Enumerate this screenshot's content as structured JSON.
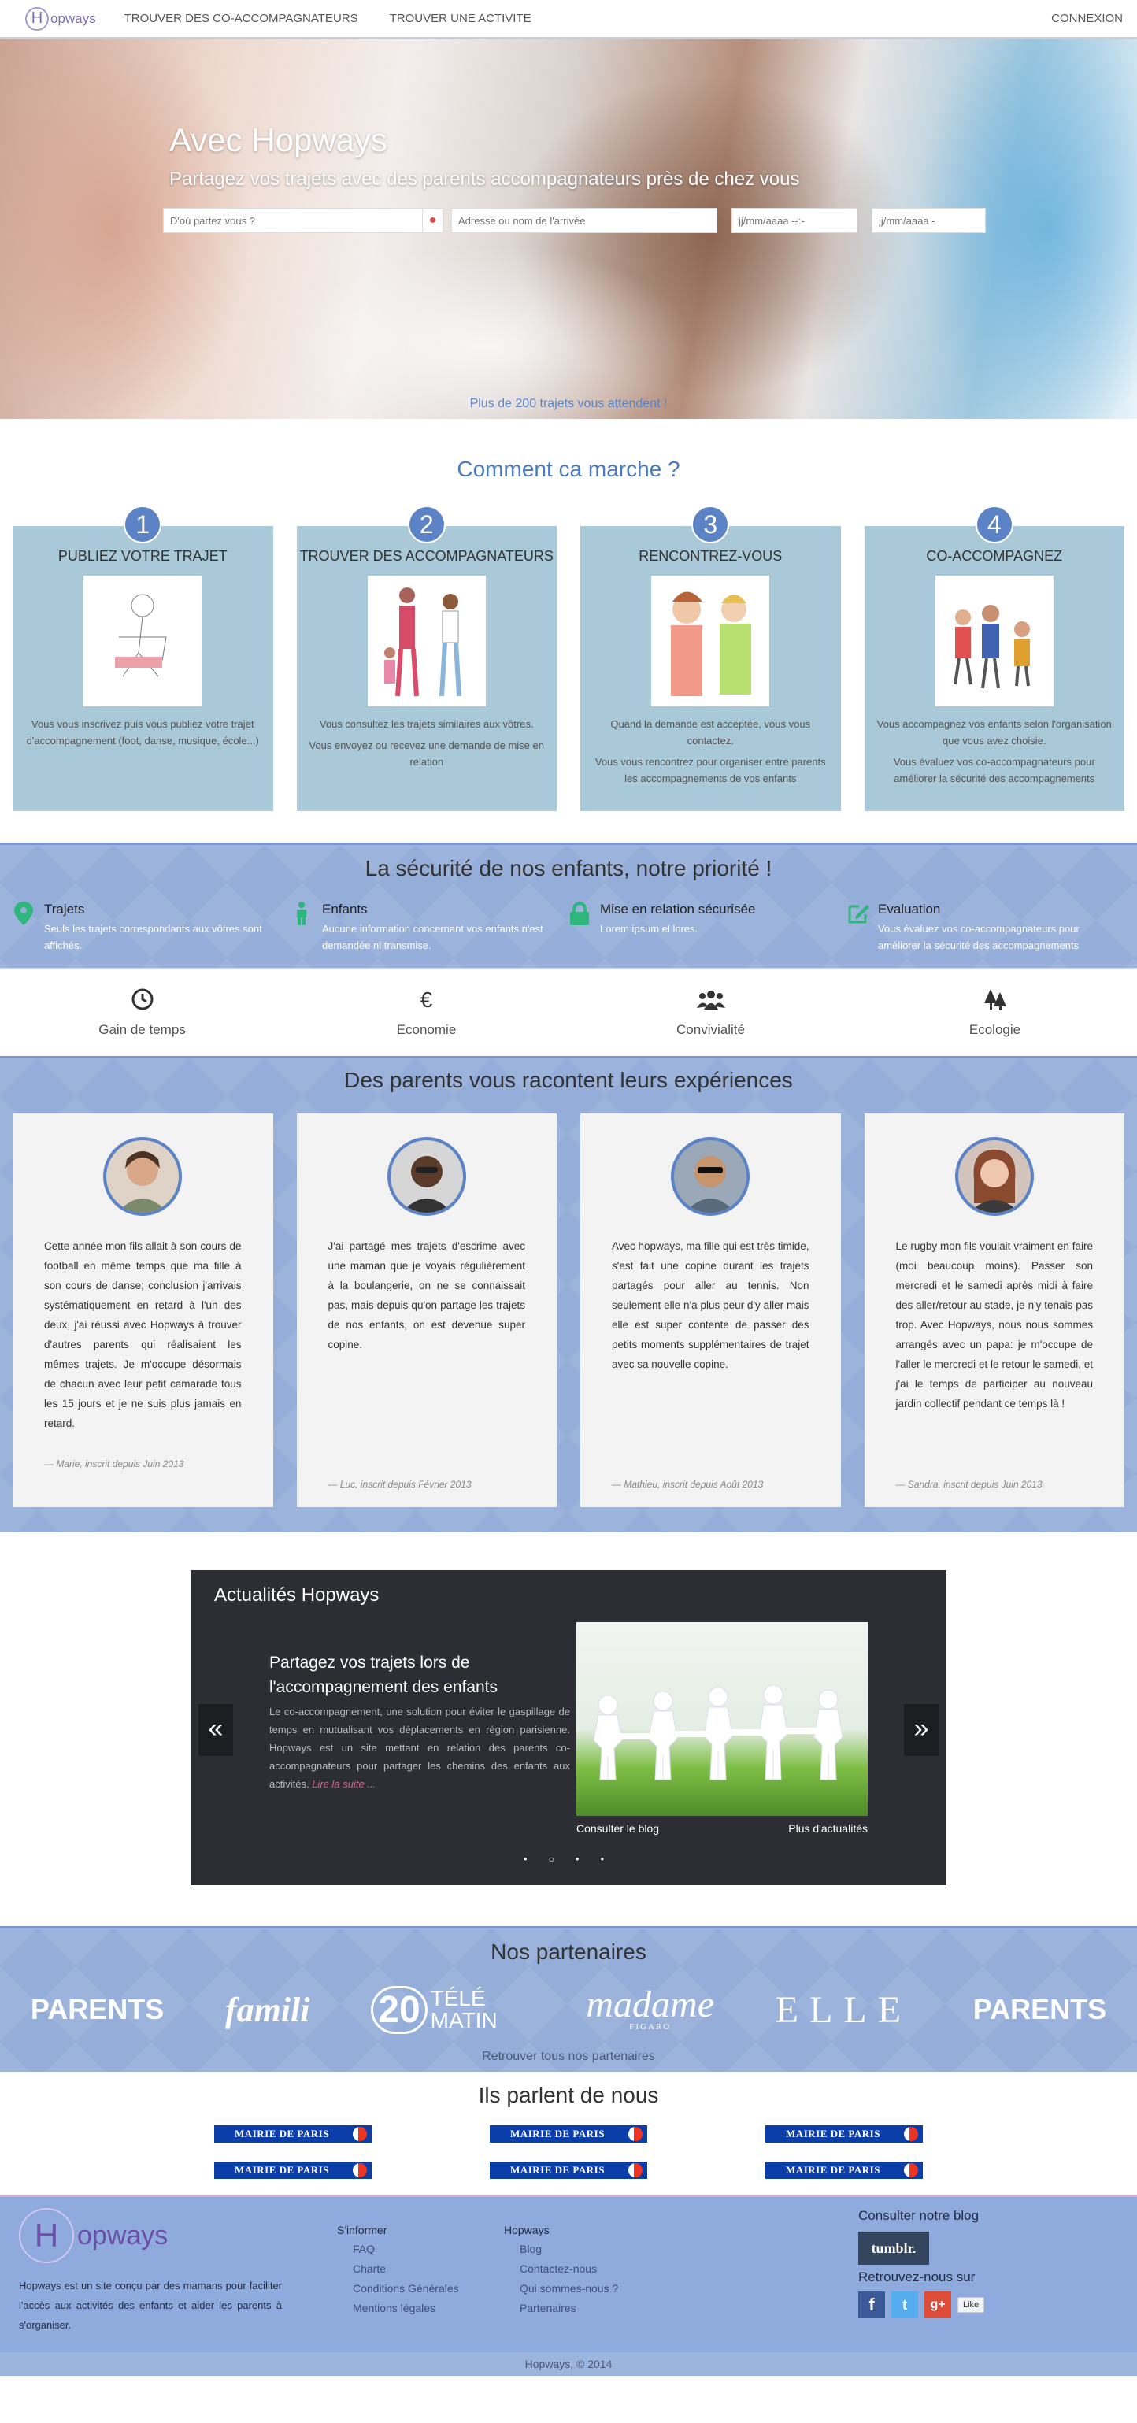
{
  "nav": {
    "logo_letter": "H",
    "logo_text": "opways",
    "links": [
      "TROUVER DES CO-ACCOMPAGNATEURS",
      "TROUVER UNE ACTIVITE"
    ],
    "login": "CONNEXION"
  },
  "hero": {
    "title": "Avec Hopways",
    "subtitle": "Partagez vos trajets avec des parents accompagnateurs près de chez vous",
    "from_placeholder": "D'où partez vous ?",
    "to_placeholder": "Adresse ou nom de l'arrivée",
    "date1_placeholder": "jj/mm/aaaa --:-",
    "date2_placeholder": "jj/mm/aaaa -",
    "more": "Plus de 200 trajets vous attendent !"
  },
  "how": {
    "title": "Comment ca marche ?",
    "steps": [
      {
        "num": "1",
        "title": "PUBLIEZ VOTRE TRAJET",
        "p1": "Vous vous inscrivez puis vous publiez votre trajet d'accompagnement (foot, danse, musique, école...)",
        "p2": ""
      },
      {
        "num": "2",
        "title": "TROUVER DES ACCOMPAGNATEURS",
        "p1": "Vous consultez les trajets similaires aux vôtres.",
        "p2": "Vous envoyez ou recevez une demande de mise en relation"
      },
      {
        "num": "3",
        "title": "RENCONTREZ-VOUS",
        "p1": "Quand la demande est acceptée, vous vous contactez.",
        "p2": "Vous vous rencontrez pour organiser entre parents les accompagnements de vos enfants"
      },
      {
        "num": "4",
        "title": "CO-ACCOMPAGNEZ",
        "p1": "Vous accompagnez vos enfants selon l'organisation que vous avez choisie.",
        "p2": "Vous évaluez vos co-accompagnateurs pour améliorer la sécurité des accompagnements"
      }
    ]
  },
  "safety": {
    "title": "La sécurité de nos enfants, notre priorité !",
    "items": [
      {
        "title": "Trajets",
        "text": "Seuls les trajets correspondants aux vôtres sont affichés."
      },
      {
        "title": "Enfants",
        "text": "Aucune information concernant vos enfants n'est demandée ni transmise."
      },
      {
        "title": "Mise en relation sécurisée",
        "text": "Lorem ipsum el lores."
      },
      {
        "title": "Evaluation",
        "text": "Vous évaluez vos co-accompagnateurs pour améliorer la sécurité des accompagnements"
      }
    ]
  },
  "benefits": [
    "Gain de temps",
    "Economie",
    "Convivialité",
    "Ecologie"
  ],
  "testimonials": {
    "title": "Des parents vous racontent leurs expériences",
    "items": [
      {
        "text": "Cette année mon fils allait à son cours de football en même temps que ma fille à son cours de danse; conclusion j'arrivais systématiquement en retard à l'un des deux, j'ai réussi avec Hopways à trouver d'autres parents qui réalisaient les mêmes trajets. Je m'occupe désormais de chacun avec leur petit camarade tous les 15 jours et je ne suis plus jamais en retard.",
        "sig": "— Marie, inscrit depuis Juin 2013"
      },
      {
        "text": "J'ai partagé mes trajets d'escrime avec une maman que je voyais régulièrement à la boulangerie, on ne se connaissait pas, mais depuis qu'on partage les trajets de nos enfants, on est devenue super copine.",
        "sig": "— Luc, inscrit depuis Février 2013"
      },
      {
        "text": "Avec hopways, ma fille qui est très timide, s'est fait une copine durant les trajets partagés pour aller au tennis. Non seulement elle n'a plus peur d'y aller mais elle est super contente de passer des petits moments supplémentaires de trajet avec sa nouvelle copine.",
        "sig": "— Mathieu, inscrit depuis Août 2013"
      },
      {
        "text": "Le rugby mon fils voulait vraiment en faire (moi beaucoup moins). Passer son mercredi et le samedi après midi à faire des aller/retour au stade, je n'y tenais pas trop. Avec Hopways, nous nous sommes arrangés avec un papa: je m'occupe de l'aller le mercredi et le retour le samedi, et j'ai le temps de participer au nouveau jardin collectif pendant ce temps là !",
        "sig": "— Sandra, inscrit depuis Juin 2013"
      }
    ]
  },
  "news": {
    "title": "Actualités Hopways",
    "headline": "Partagez vos trajets lors de l'accompagnement des enfants",
    "body": "Le co-accompagnement, une solution pour éviter le gaspillage de temps en mutualisant vos déplacements en région parisienne. Hopways est un site mettant en relation des parents co-accompagnateurs pour partager les chemins des enfants aux activités.",
    "read_more": "Lire la suite ...",
    "blog_link": "Consulter le blog",
    "more_link": "Plus d'actualités",
    "prev": "«",
    "next": "»",
    "dots": "• ○ • •"
  },
  "partners": {
    "title": "Nos partenaires",
    "logos": [
      "PARENTS",
      "famili",
      "TÉLÉ MATIN",
      "madame",
      "ELLE",
      "PARENTS"
    ],
    "telematin_num": "20",
    "madame_sub": "FIGARO",
    "all": "Retrouver tous nos partenaires"
  },
  "press": {
    "title": "Ils parlent de nous",
    "items": [
      "MAIRIE DE PARIS",
      "MAIRIE DE PARIS",
      "MAIRIE DE PARIS",
      "MAIRIE DE PARIS",
      "MAIRIE DE PARIS",
      "MAIRIE DE PARIS"
    ]
  },
  "footer": {
    "logo_letter": "H",
    "logo_text": "opways",
    "about": "Hopways est un site conçu par des mamans pour faciliter l'accès aux activités des enfants et aider les parents à s'organiser.",
    "col1": {
      "title": "S'informer",
      "links": [
        "FAQ",
        "Charte",
        "Conditions Générales",
        "Mentions légales"
      ]
    },
    "col2": {
      "title": "Hopways",
      "links": [
        "Blog",
        "Contactez-nous",
        "Qui sommes-nous ?",
        "Partenaires"
      ]
    },
    "blog_title": "Consulter notre blog",
    "tumblr": "tumblr.",
    "social_title": "Retrouvez-nous sur",
    "like": "Like",
    "copyright": "Hopways, © 2014"
  },
  "colors": {
    "accent": "#5b83c6",
    "card_blue": "#a9c8d8",
    "band": "#94add9",
    "dark": "#2d2e33",
    "green_icon": "#2fb67c"
  }
}
